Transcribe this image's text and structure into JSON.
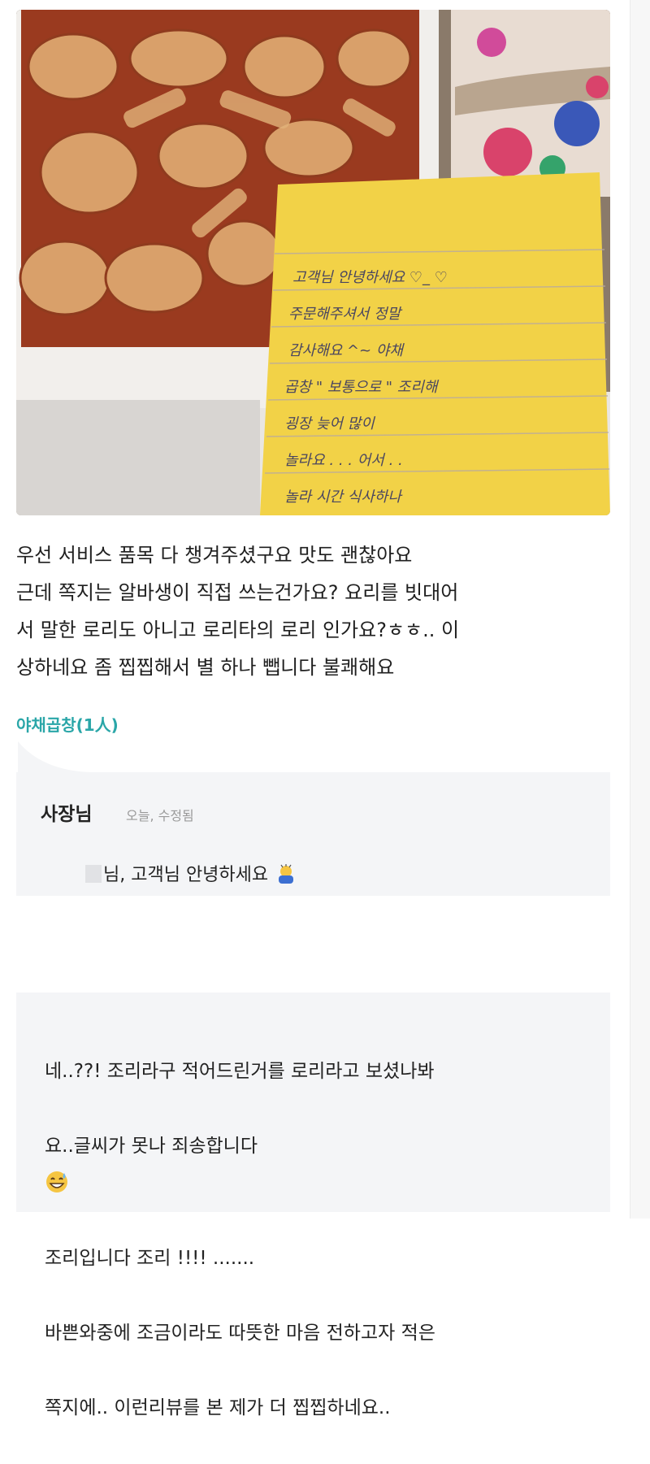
{
  "photo": {
    "note_lines": [
      "고객님 안녕하세요 ♡_♡",
      "주문해주셔서 정말",
      "감사해요 ^~ 야채",
      "곱창 \" 보통으로 \" 조리해",
      "굉장 늦어 많이",
      "놀라요 . . . 어서 . .",
      "놀라 시간 식사하나"
    ]
  },
  "review": {
    "text": "우선 서비스 품목 다 챙겨주셨구요 맛도 괜찮아요\n근데 쪽지는 알바생이 직접 쓰는건가요? 요리를 빗대어\n서 말한 로리도 아니고 로리타의 로리 인가요?ㅎㅎ.. 이\n상하네요 좀 찝찝해서 별 하나 뺍니다 불쾌해요",
    "menu_tag": "야채곱창(1人)"
  },
  "reply": {
    "owner": "사장님",
    "meta": "오늘, 수정됨",
    "greeting": "님, 고객님 안녕하세요",
    "icon": "bowing-person-emoji"
  },
  "reply2": {
    "line1": "네..??! 조리라구 적어드린거를 로리라고 보셨나봐",
    "line2": "요..글씨가 못나 죄송합니다",
    "line3": "조리입니다 조리 !!!! .......",
    "line4": "바쁜와중에 조금이라도 따뜻한 마음 전하고자 적은",
    "line5": "쪽지에.. 이런리뷰를 본 제가 더 찝찝하네요..",
    "icon": "sweat-smile-emoji"
  },
  "colors": {
    "accent": "#2aa6a8",
    "panel": "#f4f5f7",
    "note": "#f2d247"
  }
}
